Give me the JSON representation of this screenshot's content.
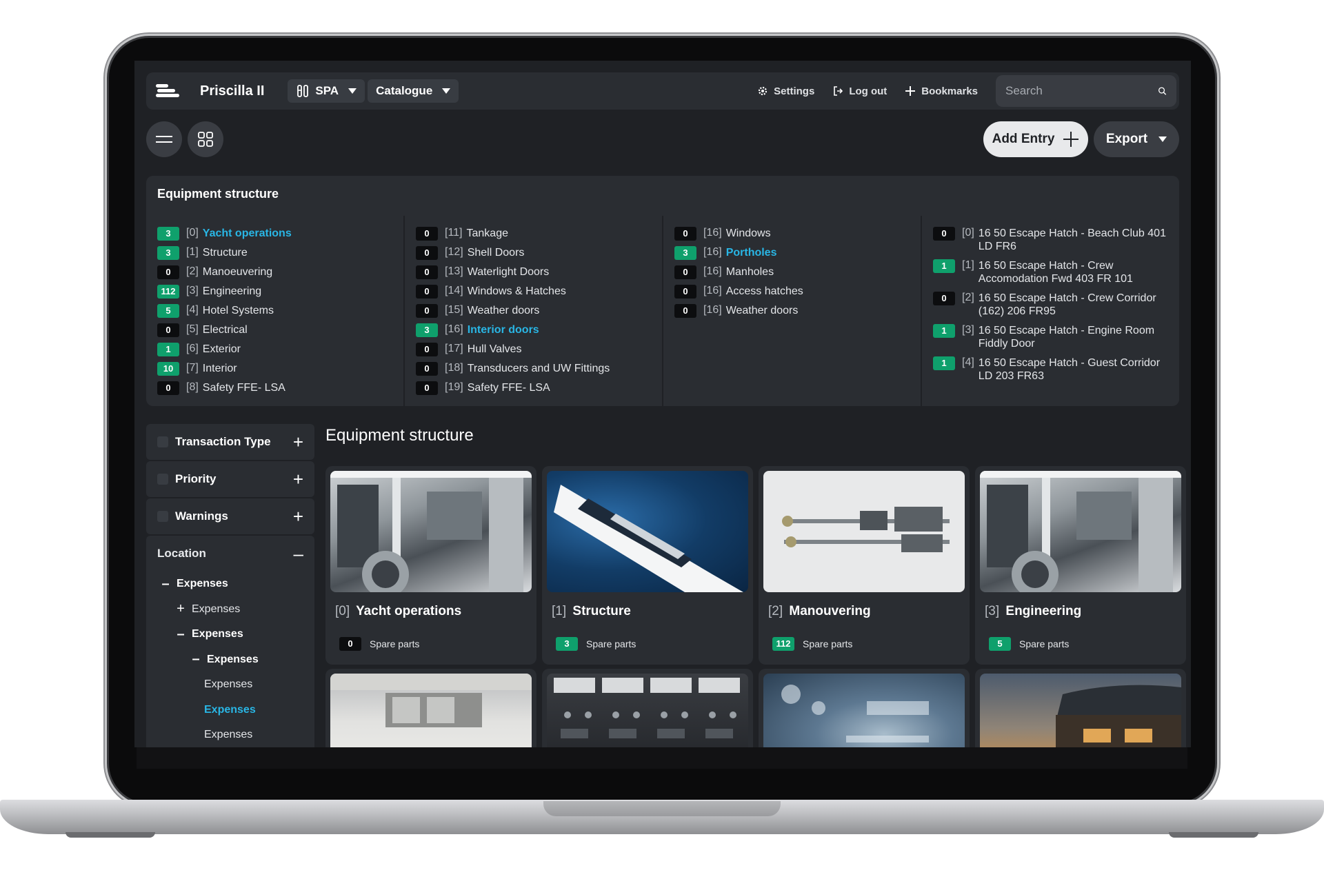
{
  "header": {
    "app_title": "Priscilla II",
    "spa_label": "SPA",
    "catalogue_label": "Catalogue",
    "settings_label": "Settings",
    "logout_label": "Log out",
    "bookmarks_label": "Bookmarks",
    "search_placeholder": "Search"
  },
  "toolbar": {
    "add_entry_label": "Add Entry",
    "export_label": "Export"
  },
  "structure_panel": {
    "title": "Equipment structure",
    "columns": [
      [
        {
          "count": "3",
          "index": "[0]",
          "label": "Yacht operations",
          "highlight": true
        },
        {
          "count": "3",
          "index": "[1]",
          "label": "Structure"
        },
        {
          "count": "0",
          "index": "[2]",
          "label": "Manoeuvering"
        },
        {
          "count": "112",
          "index": "[3]",
          "label": "Engineering"
        },
        {
          "count": "5",
          "index": "[4]",
          "label": "Hotel Systems"
        },
        {
          "count": "0",
          "index": "[5]",
          "label": "Electrical"
        },
        {
          "count": "1",
          "index": "[6]",
          "label": "Exterior"
        },
        {
          "count": "10",
          "index": "[7]",
          "label": "Interior"
        },
        {
          "count": "0",
          "index": "[8]",
          "label": "Safety FFE- LSA"
        }
      ],
      [
        {
          "count": "0",
          "index": "[11]",
          "label": "Tankage"
        },
        {
          "count": "0",
          "index": "[12]",
          "label": "Shell Doors"
        },
        {
          "count": "0",
          "index": "[13]",
          "label": "Waterlight Doors"
        },
        {
          "count": "0",
          "index": "[14]",
          "label": "Windows & Hatches"
        },
        {
          "count": "0",
          "index": "[15]",
          "label": "Weather doors"
        },
        {
          "count": "3",
          "index": "[16]",
          "label": "Interior doors",
          "highlight": true
        },
        {
          "count": "0",
          "index": "[17]",
          "label": "Hull Valves"
        },
        {
          "count": "0",
          "index": "[18]",
          "label": "Transducers and UW Fittings"
        },
        {
          "count": "0",
          "index": "[19]",
          "label": "Safety FFE- LSA"
        }
      ],
      [
        {
          "count": "0",
          "index": "[16]",
          "label": "Windows"
        },
        {
          "count": "3",
          "index": "[16]",
          "label": "Portholes",
          "highlight": true
        },
        {
          "count": "0",
          "index": "[16]",
          "label": "Manholes"
        },
        {
          "count": "0",
          "index": "[16]",
          "label": "Access hatches"
        },
        {
          "count": "0",
          "index": "[16]",
          "label": "Weather doors"
        }
      ],
      [
        {
          "count": "0",
          "index": "[0]",
          "label": "16 50 Escape Hatch - Beach Club 401 LD FR6"
        },
        {
          "count": "1",
          "index": "[1]",
          "label": "16 50 Escape Hatch - Crew Accomodation Fwd 403 FR 101"
        },
        {
          "count": "0",
          "index": "[2]",
          "label": "16 50 Escape Hatch - Crew Corridor (162) 206 FR95"
        },
        {
          "count": "1",
          "index": "[3]",
          "label": "16 50 Escape Hatch - Engine Room Fiddly Door"
        },
        {
          "count": "1",
          "index": "[4]",
          "label": "16 50 Escape Hatch - Guest Corridor LD 203 FR63"
        }
      ]
    ]
  },
  "filters": {
    "transaction_type": "Transaction Type",
    "priority": "Priority",
    "warnings": "Warnings",
    "location": "Location",
    "tree": [
      {
        "label": "Expenses",
        "symbol": "–",
        "level": 0,
        "bold": true
      },
      {
        "label": "Expenses",
        "symbol": "+",
        "level": 1,
        "bold": false
      },
      {
        "label": "Expenses",
        "symbol": "–",
        "level": 1,
        "bold": true
      },
      {
        "label": "Expenses",
        "symbol": "–",
        "level": 2,
        "bold": true
      },
      {
        "label": "Expenses",
        "symbol": "",
        "level": 3,
        "bold": false
      },
      {
        "label": "Expenses",
        "symbol": "",
        "level": 3,
        "active": true
      },
      {
        "label": "Expenses",
        "symbol": "",
        "level": 3,
        "bold": false
      }
    ]
  },
  "main": {
    "title": "Equipment structure",
    "cards": [
      {
        "index": "[0]",
        "title": "Yacht operations",
        "count": "0",
        "foot": "Spare parts",
        "image": "engine-room"
      },
      {
        "index": "[1]",
        "title": "Structure",
        "count": "3",
        "foot": "Spare parts",
        "image": "yacht-aerial"
      },
      {
        "index": "[2]",
        "title": "Manouvering",
        "count": "112",
        "foot": "Spare parts",
        "image": "propeller-shaft"
      },
      {
        "index": "[3]",
        "title": "Engineering",
        "count": "5",
        "foot": "Spare parts",
        "image": "engine-room"
      },
      {
        "index": "",
        "title": "",
        "count": "",
        "foot": "",
        "image": "galley"
      },
      {
        "index": "",
        "title": "",
        "count": "",
        "foot": "",
        "image": "switch-panel"
      },
      {
        "index": "",
        "title": "",
        "count": "",
        "foot": "",
        "image": "circuit-board"
      },
      {
        "index": "",
        "title": "",
        "count": "",
        "foot": "",
        "image": "deck-sunset"
      }
    ]
  },
  "colors": {
    "background": "#1f2125",
    "panel": "#2a2d32",
    "accent_link": "#29b6e5",
    "badge_green": "#0fa06c",
    "badge_dark": "#0c0d0f"
  }
}
